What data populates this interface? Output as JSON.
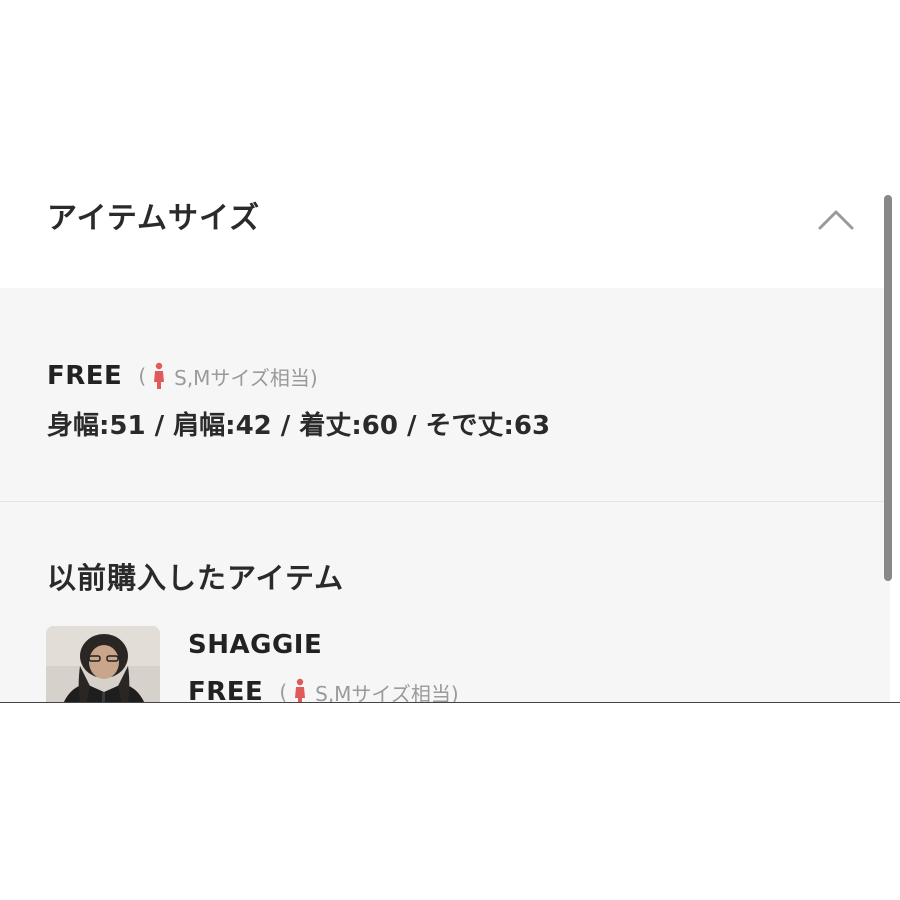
{
  "section": {
    "title": "アイテムサイズ",
    "toggle_icon": "chevron-up-icon"
  },
  "current_size": {
    "name": "FREE",
    "note_open": "(",
    "note_text": "S,Mサイズ相当)",
    "person_icon": "person-icon",
    "person_color": "#e05a5a",
    "measurements": "身幅:51 / 肩幅:42 / 着丈:60 / そで丈:63"
  },
  "previous": {
    "title": "以前購入したアイテム",
    "items": [
      {
        "brand": "SHAGGIE",
        "size_name": "FREE",
        "note_open": "(",
        "note_text": "S,Mサイズ相当)"
      }
    ]
  },
  "colors": {
    "panel_bg": "#f6f6f6",
    "text": "#222222",
    "muted": "#9a9a9a"
  }
}
